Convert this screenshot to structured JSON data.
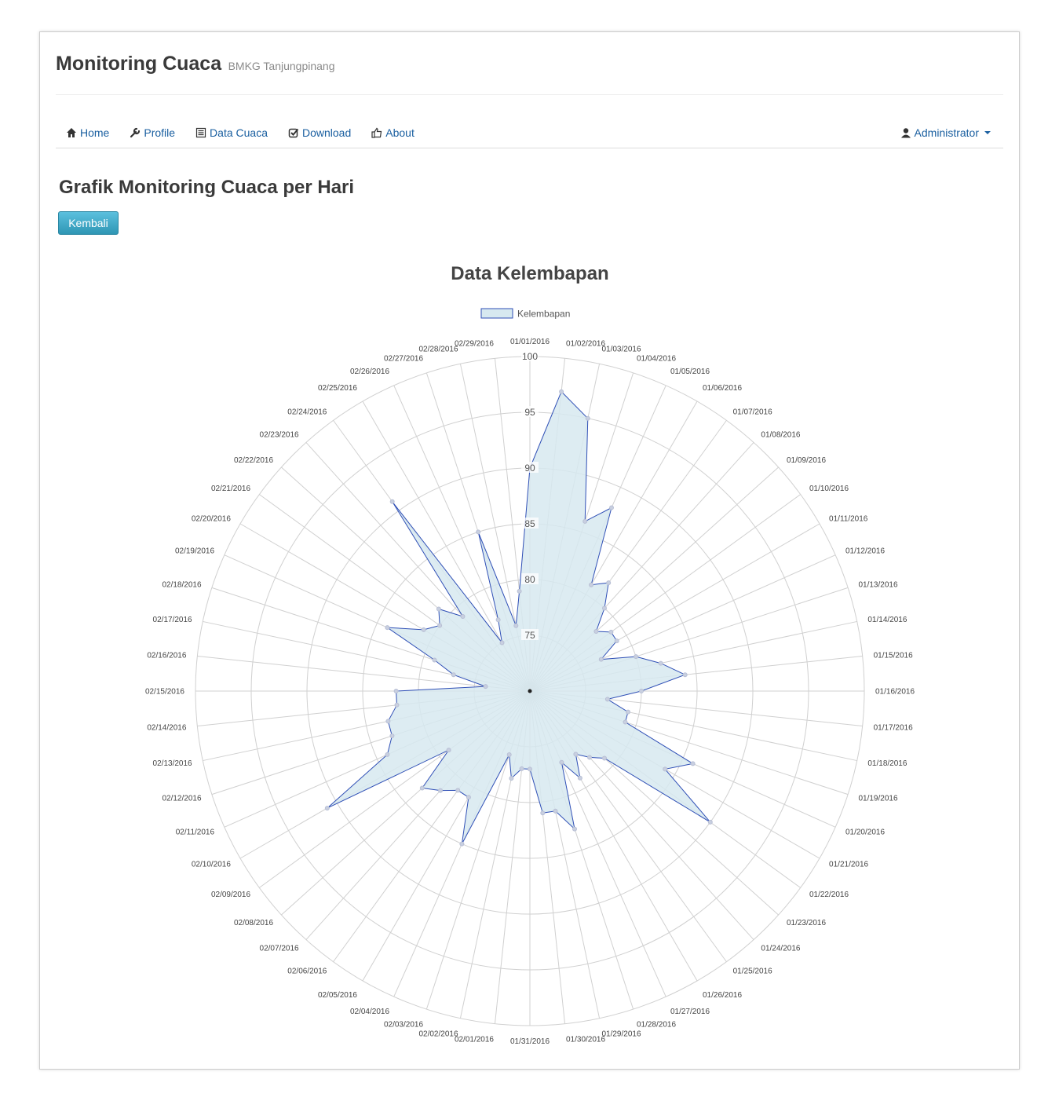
{
  "brand": {
    "title": "Monitoring Cuaca",
    "subtitle": "BMKG Tanjungpinang"
  },
  "nav": {
    "items": [
      {
        "label": "Home",
        "icon": "home-icon"
      },
      {
        "label": "Profile",
        "icon": "wrench-icon"
      },
      {
        "label": "Data Cuaca",
        "icon": "list-icon"
      },
      {
        "label": "Download",
        "icon": "check-icon"
      },
      {
        "label": "About",
        "icon": "thumbs-up-icon"
      }
    ],
    "user": {
      "label": "Administrator",
      "icon": "user-icon"
    }
  },
  "page": {
    "title": "Grafik Monitoring Cuaca per Hari",
    "back_button": "Kembali"
  },
  "colors": {
    "fill": "#d7e9f0",
    "stroke": "#2f4fb6",
    "link": "#1a5fa0",
    "button": "#49afcd"
  },
  "chart_data": {
    "type": "radar",
    "title": "Data Kelembapan",
    "legend": "top",
    "grid": true,
    "scale": {
      "min": 70,
      "max": 100,
      "ticks": [
        75,
        80,
        85,
        90,
        95,
        100
      ]
    },
    "categories": [
      "01/01/2016",
      "01/02/2016",
      "01/03/2016",
      "01/04/2016",
      "01/05/2016",
      "01/06/2016",
      "01/07/2016",
      "01/08/2016",
      "01/09/2016",
      "01/10/2016",
      "01/11/2016",
      "01/12/2016",
      "01/13/2016",
      "01/14/2016",
      "01/15/2016",
      "01/16/2016",
      "01/17/2016",
      "01/18/2016",
      "01/19/2016",
      "01/20/2016",
      "01/21/2016",
      "01/22/2016",
      "01/23/2016",
      "01/24/2016",
      "01/25/2016",
      "01/26/2016",
      "01/27/2016",
      "01/28/2016",
      "01/29/2016",
      "01/30/2016",
      "01/31/2016",
      "02/01/2016",
      "02/02/2016",
      "02/03/2016",
      "02/04/2016",
      "02/05/2016",
      "02/06/2016",
      "02/07/2016",
      "02/08/2016",
      "02/09/2016",
      "02/10/2016",
      "02/11/2016",
      "02/12/2016",
      "02/13/2016",
      "02/14/2016",
      "02/15/2016",
      "02/16/2016",
      "02/17/2016",
      "02/18/2016",
      "02/19/2016",
      "02/20/2016",
      "02/21/2016",
      "02/22/2016",
      "02/23/2016",
      "02/24/2016",
      "02/25/2016",
      "02/26/2016",
      "02/27/2016",
      "02/28/2016",
      "02/29/2016"
    ],
    "series": [
      {
        "name": "Kelembapan",
        "values": [
          90,
          97,
          95,
          86,
          88,
          81,
          82,
          80,
          78,
          79,
          79,
          77,
          80,
          82,
          84,
          80,
          77,
          79,
          79,
          86,
          84,
          90,
          79,
          78,
          77,
          79,
          77,
          83,
          81,
          81,
          77,
          77,
          78,
          76,
          85,
          81,
          81,
          82,
          83,
          79,
          91,
          84,
          83,
          83,
          82,
          82,
          74,
          77,
          79,
          84,
          81,
          80,
          81,
          79,
          91,
          75,
          77,
          85,
          76,
          79
        ]
      }
    ]
  }
}
